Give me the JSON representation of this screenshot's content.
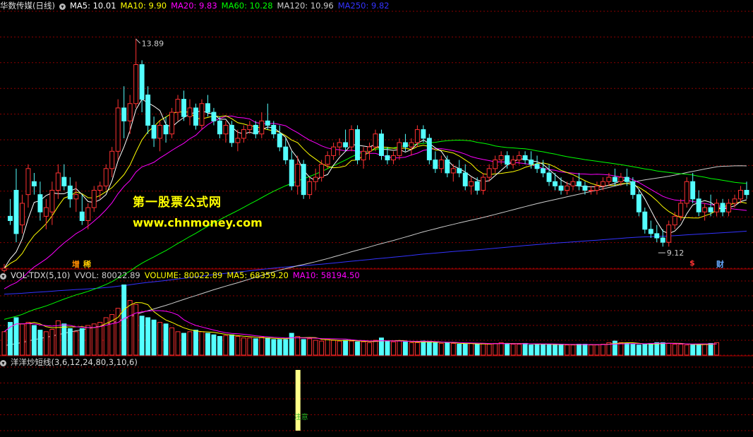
{
  "main_panel": {
    "stock_name": "华数传媒(日线)",
    "ma_labels": [
      {
        "text": "MA5: 10.01",
        "color": "#ffffff"
      },
      {
        "text": "MA10: 9.90",
        "color": "#ffff00"
      },
      {
        "text": "MA20: 9.83",
        "color": "#ff00ff"
      },
      {
        "text": "MA60: 10.28",
        "color": "#00ff00"
      },
      {
        "text": "MA120: 10.96",
        "color": "#cccccc"
      },
      {
        "text": "MA250: 9.82",
        "color": "#3333ff"
      }
    ],
    "high_label": "13.89",
    "low_label": "9.12",
    "badges": [
      {
        "text": "增",
        "color": "#ff8c00"
      },
      {
        "text": "稀",
        "color": "#ffcc00"
      },
      {
        "text": "$",
        "color": "#ff3333"
      },
      {
        "text": "财",
        "color": "#66aaff"
      }
    ]
  },
  "watermark": {
    "line1": "第一股票公式网",
    "line2": "www.chnmoney.com"
  },
  "volume_panel": {
    "title": "VOL-TDX(5,10)",
    "labels": [
      {
        "text": "VVOL: 80022.89",
        "color": "#cccccc"
      },
      {
        "text": "VOLUME: 80022.89",
        "color": "#ffff00"
      },
      {
        "text": "MA5: 68359.20",
        "color": "#ffff00"
      },
      {
        "text": "MA10: 58194.50",
        "color": "#ff00ff"
      }
    ]
  },
  "indicator_panel": {
    "title": "洋洋炒短线(3,6,12,24,80,3,10,6)",
    "signal_text": "注意"
  },
  "colors": {
    "up": "#ff3232",
    "down": "#54ffff",
    "ma5": "#ffffff",
    "ma10": "#ffff00",
    "ma20": "#ff00ff",
    "ma60": "#00ff00",
    "ma120": "#cccccc",
    "ma250": "#3333ff",
    "grid": "#8b0000",
    "signal": "#ffff88"
  },
  "chart_data": [
    {
      "type": "candlestick",
      "name": "华数传媒(日线)",
      "ylim": [
        8.6,
        14.4
      ],
      "ohlc_key": [
        "open",
        "high",
        "low",
        "close"
      ],
      "ohlc": [
        [
          8.55,
          8.7,
          8.5,
          8.6
        ],
        [
          9.8,
          10.2,
          9.6,
          9.7
        ],
        [
          10.4,
          10.9,
          9.2,
          9.4
        ],
        [
          9.6,
          10.3,
          9.4,
          10.1
        ],
        [
          10.3,
          11.0,
          10.0,
          10.9
        ],
        [
          10.6,
          10.8,
          10.3,
          10.5
        ],
        [
          10.3,
          10.6,
          9.7,
          9.9
        ],
        [
          9.8,
          10.2,
          9.5,
          10.0
        ],
        [
          9.9,
          10.6,
          9.6,
          10.4
        ],
        [
          10.4,
          11.0,
          10.2,
          10.8
        ],
        [
          10.7,
          11.0,
          10.4,
          10.5
        ],
        [
          10.5,
          10.7,
          10.0,
          10.2
        ],
        [
          10.2,
          10.6,
          9.9,
          10.3
        ],
        [
          9.9,
          10.3,
          9.6,
          9.7
        ],
        [
          9.7,
          10.1,
          9.5,
          10.0
        ],
        [
          10.0,
          10.5,
          9.9,
          10.4
        ],
        [
          10.4,
          10.6,
          10.2,
          10.5
        ],
        [
          10.5,
          11.0,
          10.4,
          10.9
        ],
        [
          10.9,
          11.4,
          10.7,
          11.3
        ],
        [
          11.3,
          12.5,
          11.1,
          12.3
        ],
        [
          12.3,
          12.8,
          11.6,
          12.0
        ],
        [
          12.0,
          12.6,
          11.7,
          12.4
        ],
        [
          12.4,
          13.9,
          12.3,
          13.3
        ],
        [
          13.3,
          13.4,
          12.2,
          12.5
        ],
        [
          12.6,
          12.8,
          11.7,
          11.9
        ],
        [
          11.9,
          12.1,
          11.4,
          11.6
        ],
        [
          11.6,
          12.0,
          11.3,
          11.9
        ],
        [
          11.9,
          12.1,
          11.5,
          11.7
        ],
        [
          11.7,
          12.3,
          11.6,
          12.2
        ],
        [
          12.2,
          12.6,
          12.0,
          12.5
        ],
        [
          12.5,
          12.7,
          12.0,
          12.1
        ],
        [
          12.1,
          12.5,
          11.9,
          12.3
        ],
        [
          12.3,
          12.4,
          11.8,
          11.9
        ],
        [
          11.9,
          12.5,
          11.8,
          12.4
        ],
        [
          12.4,
          12.6,
          12.1,
          12.2
        ],
        [
          12.2,
          12.3,
          11.9,
          12.0
        ],
        [
          12.0,
          12.1,
          11.6,
          11.7
        ],
        [
          11.7,
          12.0,
          11.5,
          11.9
        ],
        [
          11.9,
          12.0,
          11.4,
          11.5
        ],
        [
          11.5,
          11.8,
          11.3,
          11.6
        ],
        [
          11.6,
          11.9,
          11.5,
          11.8
        ],
        [
          11.8,
          12.0,
          11.7,
          11.9
        ],
        [
          11.9,
          12.0,
          11.6,
          11.7
        ],
        [
          11.7,
          12.2,
          11.6,
          12.0
        ],
        [
          12.0,
          12.4,
          11.8,
          11.9
        ],
        [
          11.9,
          12.0,
          11.6,
          11.7
        ],
        [
          11.7,
          11.9,
          11.3,
          11.4
        ],
        [
          11.4,
          11.6,
          11.0,
          11.1
        ],
        [
          11.1,
          11.3,
          10.4,
          10.5
        ],
        [
          10.5,
          11.2,
          10.3,
          11.0
        ],
        [
          11.0,
          11.1,
          10.2,
          10.3
        ],
        [
          10.3,
          10.7,
          10.2,
          10.6
        ],
        [
          10.6,
          10.9,
          10.4,
          10.7
        ],
        [
          10.7,
          11.1,
          10.6,
          11.0
        ],
        [
          11.0,
          11.3,
          10.9,
          11.2
        ],
        [
          11.2,
          11.5,
          11.1,
          11.4
        ],
        [
          11.4,
          11.6,
          11.2,
          11.5
        ],
        [
          11.5,
          11.8,
          11.3,
          11.4
        ],
        [
          11.4,
          11.9,
          11.3,
          11.8
        ],
        [
          11.8,
          11.9,
          11.0,
          11.1
        ],
        [
          11.1,
          11.4,
          10.9,
          11.3
        ],
        [
          11.3,
          11.5,
          11.1,
          11.4
        ],
        [
          11.4,
          11.8,
          11.3,
          11.7
        ],
        [
          11.7,
          11.8,
          11.1,
          11.2
        ],
        [
          11.2,
          11.4,
          11.0,
          11.1
        ],
        [
          11.1,
          11.3,
          11.0,
          11.2
        ],
        [
          11.2,
          11.6,
          11.1,
          11.5
        ],
        [
          11.5,
          11.7,
          11.3,
          11.4
        ],
        [
          11.4,
          11.6,
          11.2,
          11.5
        ],
        [
          11.5,
          11.9,
          11.4,
          11.8
        ],
        [
          11.8,
          11.9,
          11.5,
          11.6
        ],
        [
          11.6,
          11.7,
          11.0,
          11.1
        ],
        [
          11.1,
          11.3,
          10.8,
          10.9
        ],
        [
          10.9,
          11.2,
          10.8,
          11.1
        ],
        [
          11.1,
          11.2,
          10.7,
          10.8
        ],
        [
          10.8,
          11.0,
          10.6,
          10.9
        ],
        [
          10.9,
          11.1,
          10.7,
          10.8
        ],
        [
          10.8,
          11.0,
          10.4,
          10.5
        ],
        [
          10.5,
          10.7,
          10.3,
          10.6
        ],
        [
          10.6,
          10.7,
          10.3,
          10.4
        ],
        [
          10.4,
          10.8,
          10.3,
          10.7
        ],
        [
          10.7,
          11.0,
          10.6,
          10.9
        ],
        [
          10.9,
          11.2,
          10.8,
          11.1
        ],
        [
          11.1,
          11.3,
          11.0,
          11.2
        ],
        [
          11.2,
          11.3,
          10.9,
          11.0
        ],
        [
          11.0,
          11.2,
          10.9,
          11.1
        ],
        [
          11.1,
          11.3,
          11.0,
          11.2
        ],
        [
          11.2,
          11.3,
          11.0,
          11.1
        ],
        [
          11.1,
          11.3,
          10.9,
          11.0
        ],
        [
          11.0,
          11.2,
          10.8,
          10.9
        ],
        [
          10.9,
          11.1,
          10.7,
          10.8
        ],
        [
          10.8,
          11.0,
          10.5,
          10.6
        ],
        [
          10.6,
          10.8,
          10.4,
          10.5
        ],
        [
          10.5,
          10.7,
          10.3,
          10.4
        ],
        [
          10.4,
          10.6,
          10.3,
          10.5
        ],
        [
          10.5,
          10.7,
          10.4,
          10.6
        ],
        [
          10.6,
          10.8,
          10.4,
          10.5
        ],
        [
          10.5,
          10.6,
          10.3,
          10.4
        ],
        [
          10.4,
          10.5,
          10.3,
          10.4
        ],
        [
          10.4,
          10.6,
          10.3,
          10.5
        ],
        [
          10.5,
          10.7,
          10.4,
          10.6
        ],
        [
          10.6,
          10.8,
          10.5,
          10.7
        ],
        [
          10.7,
          10.9,
          10.5,
          10.6
        ],
        [
          10.6,
          10.8,
          10.5,
          10.7
        ],
        [
          10.7,
          10.9,
          10.5,
          10.6
        ],
        [
          10.6,
          10.7,
          10.2,
          10.3
        ],
        [
          10.3,
          10.4,
          9.8,
          9.9
        ],
        [
          9.9,
          10.0,
          9.4,
          9.5
        ],
        [
          9.5,
          9.7,
          9.3,
          9.4
        ],
        [
          9.4,
          9.6,
          9.2,
          9.3
        ],
        [
          9.3,
          9.5,
          9.1,
          9.2
        ],
        [
          9.2,
          9.7,
          9.1,
          9.6
        ],
        [
          9.6,
          9.9,
          9.5,
          9.8
        ],
        [
          9.8,
          10.2,
          9.7,
          10.1
        ],
        [
          10.1,
          10.7,
          10.0,
          10.6
        ],
        [
          10.6,
          10.8,
          10.1,
          10.2
        ],
        [
          10.2,
          10.4,
          9.8,
          9.9
        ],
        [
          9.9,
          10.1,
          9.7,
          10.0
        ],
        [
          10.0,
          10.3,
          9.8,
          9.9
        ],
        [
          9.9,
          10.2,
          9.8,
          10.1
        ],
        [
          10.1,
          10.2,
          9.8,
          9.9
        ],
        [
          9.9,
          10.2,
          9.8,
          10.1
        ],
        [
          10.1,
          10.3,
          10.0,
          10.2
        ],
        [
          10.2,
          10.5,
          10.1,
          10.4
        ],
        [
          10.4,
          10.6,
          10.2,
          10.3
        ]
      ],
      "moving_averages": {
        "MA5": 10.01,
        "MA10": 9.9,
        "MA20": 9.83,
        "MA60": 10.28,
        "MA120": 10.96,
        "MA250": 9.82
      },
      "annotations": [
        {
          "text": "13.89",
          "x_index": 22,
          "price": 13.89
        },
        {
          "text": "9.12",
          "x_index": 109,
          "price": 9.12
        }
      ]
    },
    {
      "type": "bar",
      "name": "VOL-TDX(5,10)",
      "series": [
        {
          "name": "VOLUME",
          "values": [
            30,
            42,
            48,
            40,
            42,
            38,
            32,
            30,
            33,
            44,
            40,
            34,
            30,
            34,
            38,
            40,
            42,
            48,
            52,
            60,
            90,
            70,
            65,
            50,
            48,
            45,
            42,
            40,
            35,
            30,
            28,
            30,
            32,
            30,
            28,
            26,
            24,
            25,
            26,
            24,
            22,
            22,
            21,
            23,
            22,
            20,
            20,
            20,
            28,
            24,
            20,
            21,
            19,
            18,
            20,
            19,
            18,
            19,
            18,
            17,
            17,
            16,
            19,
            22,
            18,
            17,
            18,
            17,
            16,
            16,
            18,
            17,
            16,
            15,
            16,
            15,
            14,
            14,
            15,
            14,
            15,
            14,
            15,
            16,
            15,
            14,
            14,
            15,
            13,
            14,
            14,
            14,
            13,
            14,
            13,
            13,
            14,
            14,
            13,
            13,
            14,
            16,
            18,
            16,
            15,
            14,
            13,
            14,
            15,
            16,
            16,
            15,
            14,
            14,
            13,
            13,
            14,
            14,
            15,
            16
          ]
        }
      ],
      "last": {
        "VVOL": 80022.89,
        "VOLUME": 80022.89,
        "MA5": 68359.2,
        "MA10": 58194.5
      }
    },
    {
      "type": "bar",
      "name": "洋洋炒短线",
      "signal_x_index": 49
    }
  ]
}
